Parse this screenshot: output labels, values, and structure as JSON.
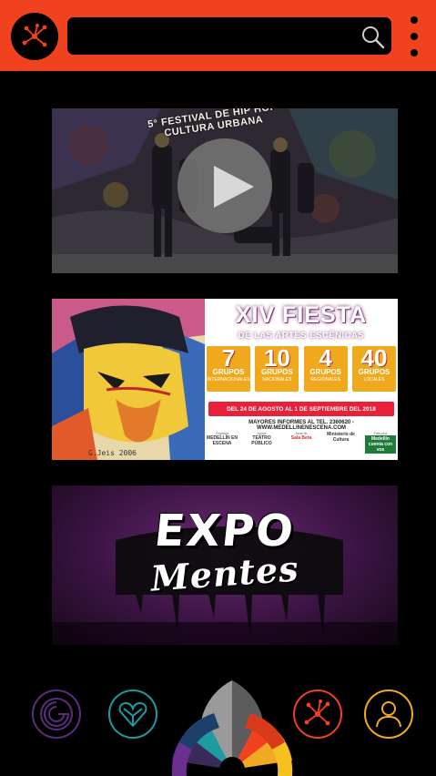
{
  "header": {
    "logo_icon": "network-share-icon",
    "search": {
      "value": "",
      "placeholder": "",
      "icon": "search-icon"
    },
    "menu_icon": "more-vertical-icon",
    "color": "#f0421f"
  },
  "feed": {
    "video": {
      "mural_text": "5° FESTIVAL DE HIP HOP CULTURA URBANA",
      "play_icon": "play-icon"
    },
    "poster": {
      "title": "XIV FIESTA",
      "subtitle": "DE LAS ARTES ESCÉNICAS",
      "stats": [
        {
          "number": "7",
          "label": "GRUPOS",
          "sub": "INTERNACIONALES"
        },
        {
          "number": "10",
          "label": "GRUPOS",
          "sub": "NACIONALES"
        },
        {
          "number": "4",
          "label": "GRUPOS",
          "sub": "REGIONALES"
        },
        {
          "number": "40",
          "label": "GRUPOS",
          "sub": "LOCALES"
        }
      ],
      "dates": "DEL 24 DE AGOSTO AL 1 DE SEPTIEMBRE DEL 2018",
      "info": "MAYORES INFORMES AL TEL. 2360620 - WWW.MEDELLINENESCENA.COM",
      "logos": [
        {
          "caption": "Organiza",
          "name": "MEDELLÍN EN ESCENA"
        },
        {
          "caption": "Apoya",
          "name": "TEATRO PÚBLICO"
        },
        {
          "caption": "Sede de",
          "name": "Sala Beta"
        },
        {
          "caption": "",
          "name": "Ministerio de Cultura"
        },
        {
          "caption": "Patrocina",
          "name": "Medellín cuenta con vos"
        }
      ],
      "accent": "#e8203a",
      "stat_color": "#f0a81c"
    },
    "expo": {
      "line1": "EXPO",
      "line2": "Mentes",
      "bg_color": "#6b2a73"
    }
  },
  "bottom_nav": {
    "items": [
      {
        "icon": "spiral-circle-icon",
        "color": "#5a2d7e"
      },
      {
        "icon": "heart-network-icon",
        "color": "#1e9aa1"
      },
      {
        "icon": "color-wheel-fan-icon",
        "color": "#888888"
      },
      {
        "icon": "network-share-icon",
        "color": "#f0421f"
      },
      {
        "icon": "user-profile-icon",
        "color": "#f2a922"
      }
    ]
  }
}
